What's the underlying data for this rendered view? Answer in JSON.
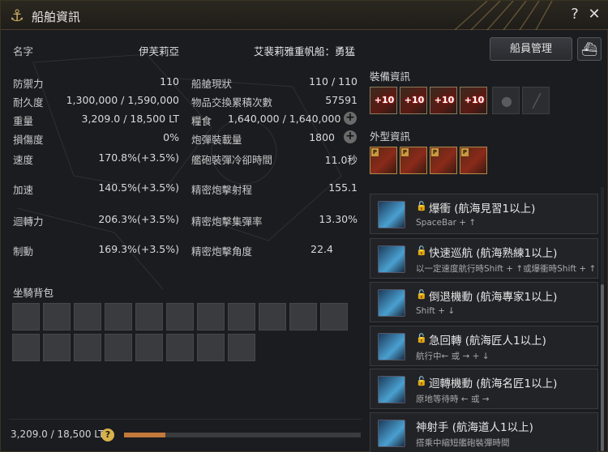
{
  "window": {
    "title": "船舶資訊"
  },
  "header": {
    "name_label": "名字",
    "name_value": "伊芙莉亞",
    "ship_type": "艾裴莉雅重帆船：勇猛"
  },
  "buttons": {
    "crew_manage": "船員管理"
  },
  "stats_left": [
    {
      "label": "防禦力",
      "value": "110"
    },
    {
      "label": "耐久度",
      "value": "1,300,000 / 1,590,000"
    },
    {
      "label": "重量",
      "value": "3,209.0 / 18,500 LT"
    },
    {
      "label": "損傷度",
      "value": "0%"
    },
    {
      "label": "速度",
      "value": "170.8%(+3.5%)"
    },
    {
      "label": "加速",
      "value": "140.5%(+3.5%)"
    },
    {
      "label": "迴轉力",
      "value": "206.3%(+3.5%)"
    },
    {
      "label": "制動",
      "value": "169.3%(+3.5%)"
    }
  ],
  "stats_right": [
    {
      "label": "船艙現狀",
      "value": "110 / 110"
    },
    {
      "label": "物品交換累積次數",
      "value": "57591"
    },
    {
      "label": "糧食",
      "value": "1,640,000 / 1,640,000"
    },
    {
      "label": "炮彈裝載量",
      "value": "1800"
    },
    {
      "label": "艦砲裝彈冷卻時間",
      "value": "11.0秒"
    },
    {
      "label": "精密炮擊射程",
      "value": "155.1"
    },
    {
      "label": "精密炮擊集彈率",
      "value": "13.30%"
    },
    {
      "label": "精密炮擊角度",
      "value": "22.4"
    }
  ],
  "equipment": {
    "title": "裝備資訊",
    "slots": [
      {
        "enhance": "+10",
        "icon": "ship-figurehead-icon"
      },
      {
        "enhance": "+10",
        "icon": "ship-plating-icon"
      },
      {
        "enhance": "+10",
        "icon": "ship-cannon-icon"
      },
      {
        "enhance": "+10",
        "icon": "ship-sail-icon"
      },
      {
        "enhance": "",
        "icon": "crew-empty-icon"
      },
      {
        "enhance": "",
        "icon": "fishing-rod-empty-icon"
      }
    ]
  },
  "appearance": {
    "title": "外型資訊",
    "slots": [
      {
        "icon": "outfit-ship-icon"
      },
      {
        "icon": "outfit-figurehead-icon"
      },
      {
        "icon": "outfit-cannon-icon"
      },
      {
        "icon": "outfit-sail-icon"
      }
    ]
  },
  "skills": [
    {
      "name": "爆衝 (航海見習1以上)",
      "keys": "SpaceBar + ↑",
      "locked": true,
      "icon": "burst-skill-icon"
    },
    {
      "name": "快速巡航 (航海熟練1以上)",
      "keys": "以一定速度航行時Shift + ↑或爆衝時Shift + ↑",
      "locked": true,
      "icon": "cruise-skill-icon"
    },
    {
      "name": "倒退機動 (航海專家1以上)",
      "keys": "Shift + ↓",
      "locked": true,
      "icon": "reverse-skill-icon"
    },
    {
      "name": "急回轉 (航海匠人1以上)",
      "keys": "航行中← 或 → + ↓",
      "locked": true,
      "icon": "sharp-turn-skill-icon"
    },
    {
      "name": "迴轉機動 (航海名匠1以上)",
      "keys": "原地等待時 ← 或 →",
      "locked": true,
      "icon": "spin-skill-icon"
    },
    {
      "name": "神射手 (航海道人1以上)",
      "keys": "搭乘中縮短艦砲裝彈時間",
      "locked": false,
      "icon": "marksman-skill-icon"
    }
  ],
  "cargo": {
    "title": "坐騎背包",
    "weight_text": "3,209.0 / 18,500 LT",
    "weight_fraction": 0.173,
    "slot_count": 19
  },
  "colors": {
    "accent_gold": "#c9a860",
    "weight_fill": "#c2793a",
    "help_yellow": "#d8b24a"
  }
}
